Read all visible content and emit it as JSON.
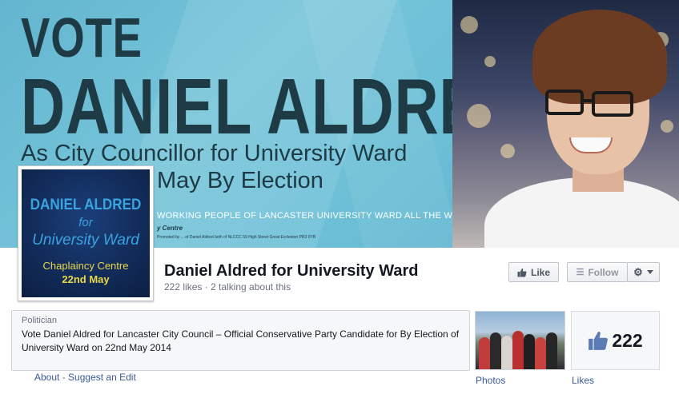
{
  "cover": {
    "vote": "VOTE",
    "candidate": "DANIEL ALDRED",
    "subtitle_1": "As City Councillor for University Ward",
    "subtitle_2": "May By Election",
    "slogan": "WORKING PEOPLE OF LANCASTER UNIVERSITY WARD ALL THE WAY!",
    "venue": "y Centre",
    "imprint": "Promoted by ... of Daniel Aldred both of NLCCC 59 High Street Great Eccleston PR3 0YB"
  },
  "profile_picture": {
    "name": "DANIEL ALDRED",
    "for": "for",
    "ward": "University Ward",
    "venue": "Chaplaincy Centre",
    "date": "22nd May"
  },
  "page": {
    "name": "Daniel Aldred for University Ward",
    "stats": "222 likes · 2 talking about this"
  },
  "buttons": {
    "like": "Like",
    "follow": "Follow"
  },
  "about": {
    "category": "Politician",
    "description": "Vote Daniel Aldred for Lancaster City Council – Official Conservative Party Candidate for By Election of University Ward on 22nd May 2014",
    "about_link": "About",
    "separator": "-",
    "suggest_edit": "Suggest an Edit"
  },
  "tiles": {
    "photos_label": "Photos",
    "likes_count": "222",
    "likes_label": "Likes"
  },
  "icons": {
    "like": "thumbs-up-icon",
    "follow": "rss-icon",
    "settings": "gear-icon",
    "dropdown": "caret-down-icon"
  },
  "colors": {
    "cover_bg": "#6cbfd6",
    "cover_text": "#1d3a45",
    "link": "#3b5998",
    "profile_bg": "#122c5a",
    "profile_text": "#3aa3e0",
    "profile_accent": "#e8d84a"
  }
}
